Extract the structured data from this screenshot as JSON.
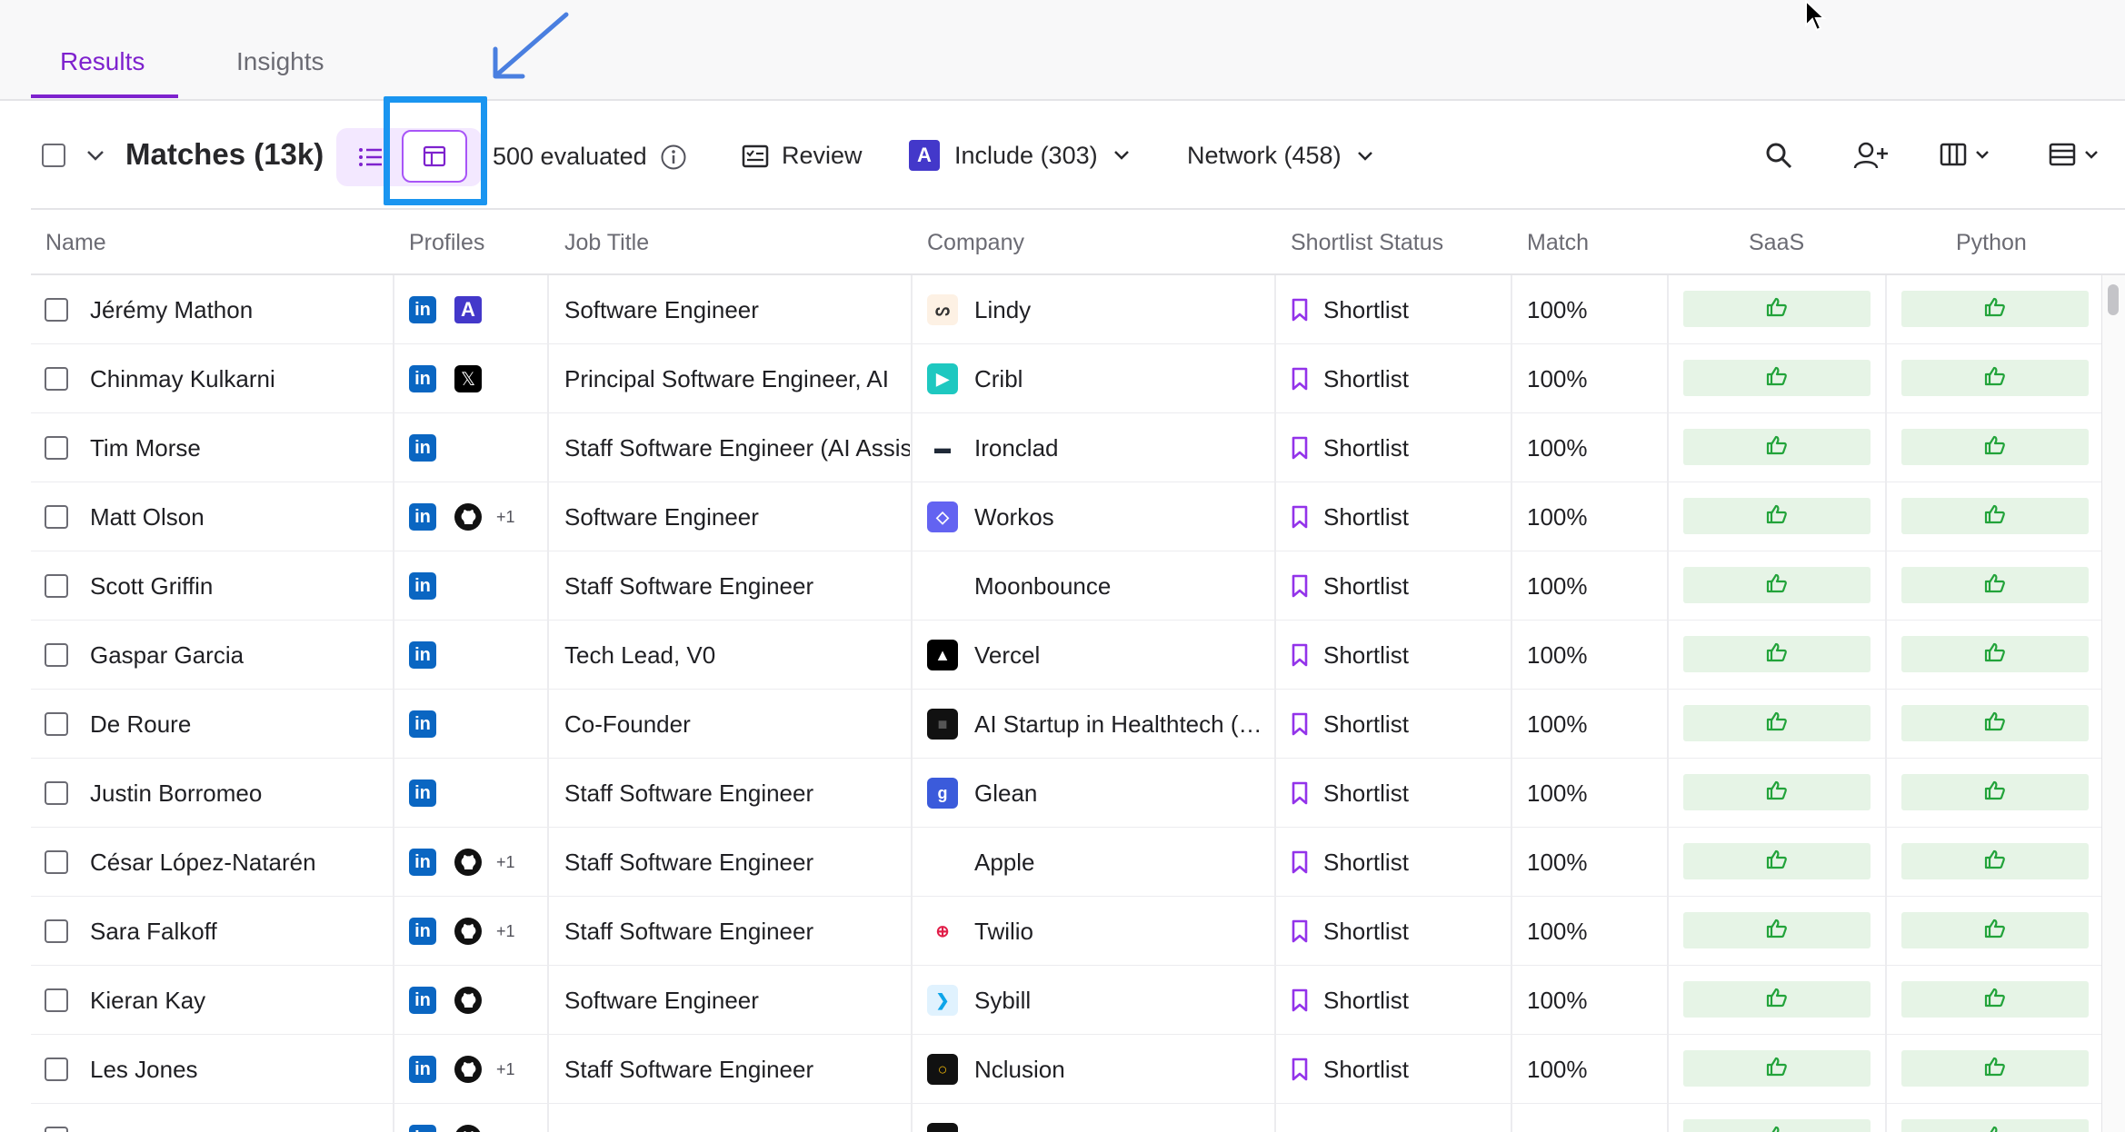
{
  "tabs": [
    {
      "label": "Results",
      "active": true
    },
    {
      "label": "Insights",
      "active": false
    }
  ],
  "toolbar": {
    "matches_label": "Matches (13k)",
    "evaluated_label": "500 evaluated",
    "review_label": "Review",
    "include_label": "Include (303)",
    "network_label": "Network (458)"
  },
  "columns": [
    "Name",
    "Profiles",
    "Job Title",
    "Company",
    "Shortlist Status",
    "Match",
    "SaaS",
    "Python"
  ],
  "rows": [
    {
      "name": "Jérémy Mathon",
      "profiles": [
        "linkedin",
        "a"
      ],
      "extra": "",
      "job": "Software Engineer",
      "company": "Lindy",
      "logo": {
        "text": "ᔕ",
        "bg": "#fdf1e4",
        "fg": "#333333"
      },
      "status": "Shortlist",
      "match": "100%"
    },
    {
      "name": "Chinmay Kulkarni",
      "profiles": [
        "linkedin",
        "x"
      ],
      "extra": "",
      "job": "Principal Software Engineer, AI",
      "company": "Cribl",
      "logo": {
        "text": "▶",
        "bg": "#1ec8c0",
        "fg": "#ffffff"
      },
      "status": "Shortlist",
      "match": "100%"
    },
    {
      "name": "Tim Morse",
      "profiles": [
        "linkedin"
      ],
      "extra": "",
      "job": "Staff Software Engineer (AI Assistant)",
      "company": "Ironclad",
      "logo": {
        "text": "▬",
        "bg": "#ffffff",
        "fg": "#1f2937"
      },
      "status": "Shortlist",
      "match": "100%"
    },
    {
      "name": "Matt Olson",
      "profiles": [
        "linkedin",
        "github"
      ],
      "extra": "+1",
      "job": "Software Engineer",
      "company": "Workos",
      "logo": {
        "text": "◇",
        "bg": "#6363f1",
        "fg": "#ffffff"
      },
      "status": "Shortlist",
      "match": "100%"
    },
    {
      "name": "Scott Griffin",
      "profiles": [
        "linkedin"
      ],
      "extra": "",
      "job": "Staff Software Engineer",
      "company": "Moonbounce",
      "logo": {
        "text": "",
        "bg": "#ffffff",
        "fg": "#ffffff"
      },
      "status": "Shortlist",
      "match": "100%"
    },
    {
      "name": "Gaspar Garcia",
      "profiles": [
        "linkedin"
      ],
      "extra": "",
      "job": "Tech Lead, V0",
      "company": "Vercel",
      "logo": {
        "text": "▲",
        "bg": "#000000",
        "fg": "#ffffff"
      },
      "status": "Shortlist",
      "match": "100%"
    },
    {
      "name": "De Roure",
      "profiles": [
        "linkedin"
      ],
      "extra": "",
      "job": "Co-Founder",
      "company": "AI Startup in Healthtech (…",
      "logo": {
        "text": "■",
        "bg": "#111111",
        "fg": "#555555"
      },
      "status": "Shortlist",
      "match": "100%"
    },
    {
      "name": "Justin Borromeo",
      "profiles": [
        "linkedin"
      ],
      "extra": "",
      "job": "Staff Software Engineer",
      "company": "Glean",
      "logo": {
        "text": "g",
        "bg": "#3b5bdb",
        "fg": "#ffffff"
      },
      "status": "Shortlist",
      "match": "100%"
    },
    {
      "name": "César López-Natarén",
      "profiles": [
        "linkedin",
        "github"
      ],
      "extra": "+1",
      "job": "Staff Software Engineer",
      "company": "Apple",
      "logo": {
        "text": "",
        "bg": "#ffffff",
        "fg": "#111111"
      },
      "status": "Shortlist",
      "match": "100%"
    },
    {
      "name": "Sara Falkoff",
      "profiles": [
        "linkedin",
        "github"
      ],
      "extra": "+1",
      "job": "Staff Software Engineer",
      "company": "Twilio",
      "logo": {
        "text": "⊕",
        "bg": "#ffffff",
        "fg": "#e11d48"
      },
      "status": "Shortlist",
      "match": "100%"
    },
    {
      "name": "Kieran Kay",
      "profiles": [
        "linkedin",
        "github"
      ],
      "extra": "",
      "job": "Software Engineer",
      "company": "Sybill",
      "logo": {
        "text": "❯",
        "bg": "#e0f2fe",
        "fg": "#0ea5e9"
      },
      "status": "Shortlist",
      "match": "100%"
    },
    {
      "name": "Les Jones",
      "profiles": [
        "linkedin",
        "github"
      ],
      "extra": "+1",
      "job": "Staff Software Engineer",
      "company": "Nclusion",
      "logo": {
        "text": "○",
        "bg": "#111111",
        "fg": "#eab308"
      },
      "status": "Shortlist",
      "match": "100%"
    },
    {
      "name": "",
      "profiles": [
        "linkedin",
        "github"
      ],
      "extra": "",
      "job": "",
      "company": "",
      "logo": {
        "text": "",
        "bg": "#111111",
        "fg": "#ffffff"
      },
      "status": "",
      "match": ""
    }
  ],
  "colors": {
    "accent": "#7e22ce",
    "highlight": "#1a95f0",
    "thumb_bg": "#e6f4e6",
    "thumb_fg": "#22a33a"
  },
  "icons": [
    "info-icon",
    "review-icon",
    "chevron-down-icon",
    "search-icon",
    "add-user-icon",
    "columns-icon",
    "table-layout-icon",
    "list-view-icon",
    "card-view-icon",
    "bookmark-icon",
    "thumbs-up-icon",
    "cursor-icon",
    "arrow-annotation-icon"
  ]
}
